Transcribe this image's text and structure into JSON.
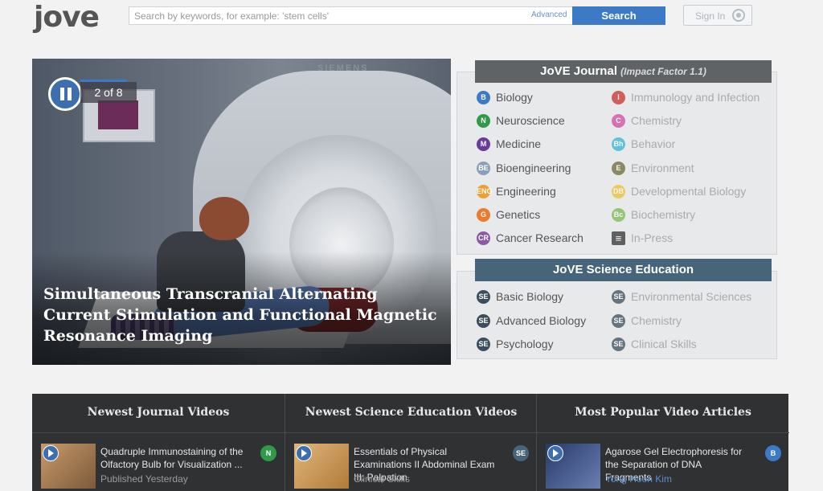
{
  "header": {
    "logo_text": "jove",
    "search_placeholder": "Search by keywords, for example: 'stem cells'",
    "advanced_label": "Advanced",
    "search_button": "Search",
    "signin_label": "Sign In"
  },
  "hero": {
    "slide_counter": "2 of 8",
    "slide_current": 2,
    "slide_total": 8,
    "scanner_brand": "SIEMENS",
    "title": "Simultaneous Transcranial Alternating Current Stimulation and Functional Magnetic Resonance Imaging"
  },
  "journal": {
    "title": "JoVE Journal",
    "impact": "(Impact Factor 1.1)",
    "left": [
      {
        "badge": "B",
        "label": "Biology",
        "color": "#3d7ac6"
      },
      {
        "badge": "N",
        "label": "Neuroscience",
        "color": "#2e9a4a"
      },
      {
        "badge": "M",
        "label": "Medicine",
        "color": "#6a3c9c"
      },
      {
        "badge": "BE",
        "label": "Bioengineering",
        "color": "#8aa0b8"
      },
      {
        "badge": "ENG",
        "label": "Engineering",
        "color": "#f0a030"
      },
      {
        "badge": "G",
        "label": "Genetics",
        "color": "#ee7a2c"
      },
      {
        "badge": "CR",
        "label": "Cancer Research",
        "color": "#8a5aa8"
      }
    ],
    "right": [
      {
        "badge": "I",
        "label": "Immunology and Infection",
        "color": "#c8302c"
      },
      {
        "badge": "C",
        "label": "Chemistry",
        "color": "#d04aa0"
      },
      {
        "badge": "Bh",
        "label": "Behavior",
        "color": "#35b4d8"
      },
      {
        "badge": "E",
        "label": "Environment",
        "color": "#6a6a3a"
      },
      {
        "badge": "DB",
        "label": "Developmental Biology",
        "color": "#f0c030"
      },
      {
        "badge": "Bc",
        "label": "Biochemistry",
        "color": "#7ab850"
      },
      {
        "badge": "",
        "label": "In-Press",
        "color": "#333333"
      }
    ]
  },
  "education": {
    "title": "JoVE Science Education",
    "left": [
      {
        "badge": "SE",
        "label": "Basic Biology"
      },
      {
        "badge": "SE",
        "label": "Advanced Biology"
      },
      {
        "badge": "SE",
        "label": "Psychology"
      }
    ],
    "right": [
      {
        "badge": "SE",
        "label": "Environmental Sciences"
      },
      {
        "badge": "SE",
        "label": "Chemistry"
      },
      {
        "badge": "SE",
        "label": "Clinical Skills"
      }
    ]
  },
  "bottom": {
    "journal": {
      "title": "Newest Journal Videos",
      "video_title": "Quadruple Immunostaining of the Olfactory Bulb for Visualization ...",
      "meta": "Published Yesterday",
      "badge": "N"
    },
    "education": {
      "title": "Newest Science Education Videos",
      "video_title": "Essentials of Physical Examinations II Abdominal Exam III: Palpation",
      "meta": "Clinical Skills",
      "badge": "SE"
    },
    "popular": {
      "title": "Most Popular Video Articles",
      "video_title": "Agarose Gel Electrophoresis for the Separation of DNA Fragments",
      "meta": "Yong Hoon Kim",
      "badge": "B"
    }
  }
}
